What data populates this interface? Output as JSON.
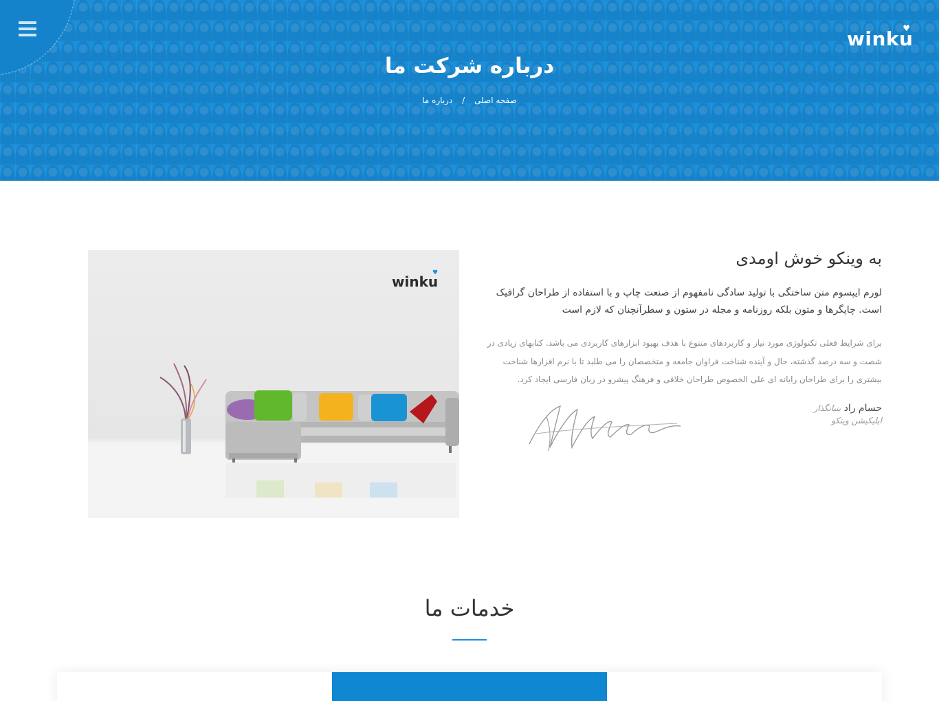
{
  "header": {
    "logo_text": "winku",
    "title": "درباره شرکت ما",
    "breadcrumb": {
      "home": "صفحه اصلی",
      "separator": "/",
      "current": "درباره ما"
    }
  },
  "about": {
    "image_logo": "winku",
    "heading": "به وینکو خوش اومدی",
    "lead": "لورم ایپسوم متن ساختگی با تولید سادگی نامفهوم از صنعت چاپ و با استفاده از طراحان گرافیک است. چاپگرها و متون بلکه روزنامه و مجله در ستون و سطرآنچنان که لازم است",
    "body": "برای شرایط فعلی تکنولوژی مورد نیاز و کاربردهای متنوع با هدف بهبود ابزارهای کاربردی می باشد. کتابهای زیادی در شصت و سه درصد گذشته، حال و آینده شناخت فراوان جامعه و متخصصان را می طلبد تا با نرم افزارها شناخت بیشتری را برای طراحان رایانه ای علی الخصوص طراحان خلاقی و فرهنگ پیشرو در زبان فارسی ایجاد کرد.",
    "author_name": "حسام راد",
    "author_role": "بنیانگذار",
    "author_org": "اپلیکیشن وینکو"
  },
  "services": {
    "title": "خدمات ما"
  },
  "colors": {
    "brand_blue": "#1a8fd8",
    "active_card": "#0f87d1"
  },
  "icons": {
    "menu": "hamburger-menu-icon"
  }
}
